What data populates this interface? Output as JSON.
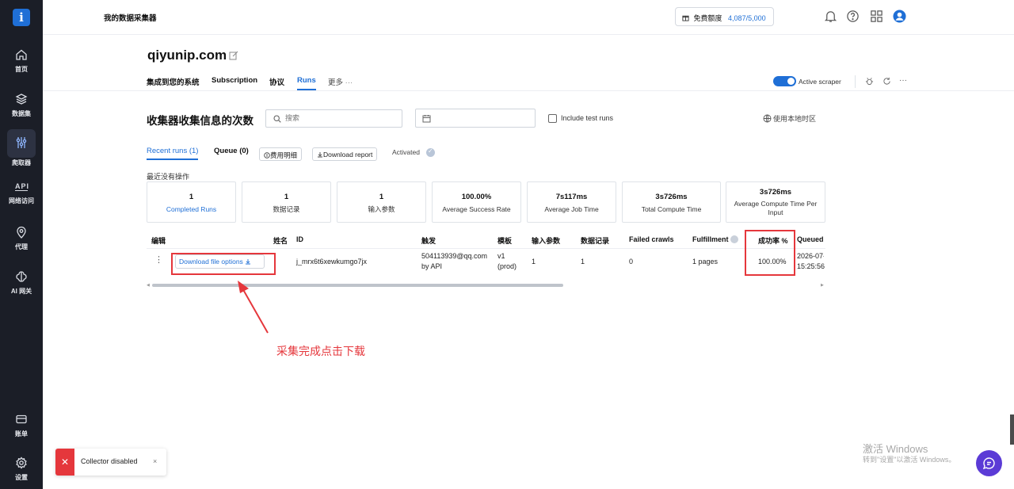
{
  "sidebar": {
    "logo": "i",
    "items": [
      {
        "label": "首页",
        "icon": "home-icon"
      },
      {
        "label": "数据集",
        "icon": "dataset-icon"
      },
      {
        "label": "爬取器",
        "icon": "scraper-icon",
        "active": true
      },
      {
        "label": "网络访问",
        "icon": "api-icon"
      },
      {
        "label": "代理",
        "icon": "proxy-pin-icon"
      },
      {
        "label": "AI 网关",
        "icon": "ai-gateway-icon"
      },
      {
        "label": "账单",
        "icon": "billing-icon"
      },
      {
        "label": "设置",
        "icon": "settings-gear-icon"
      }
    ],
    "api_text": "API"
  },
  "header": {
    "app_title": "我的数据采集器",
    "quota_label": "免费额度",
    "quota_value": "4,087/5,000"
  },
  "page": {
    "site_title": "qiyunip.com",
    "tabs": [
      "集成到您的系统",
      "Subscription",
      "协议",
      "Runs",
      "更多"
    ],
    "active_tab": "Runs",
    "more_dots": "···",
    "toggle_label": "Active scraper",
    "toggle_on": true,
    "header_dots": "···"
  },
  "runs": {
    "title": "收集器收集信息的次数",
    "search_placeholder": "搜索",
    "include_test_label": "Include test runs",
    "timezone_label": "使用本地时区",
    "subtabs": [
      "Recent runs (1)",
      "Queue (0)"
    ],
    "fees_label": "费用明细",
    "download_report": "Download report",
    "activated": "Activated",
    "recent_label": "最近没有操作",
    "stats": [
      {
        "value": "1",
        "label": "Completed Runs"
      },
      {
        "value": "1",
        "label": "数据记录"
      },
      {
        "value": "1",
        "label": "输入参数"
      },
      {
        "value": "100.00%",
        "label": "Average Success Rate"
      },
      {
        "value": "7s117ms",
        "label": "Average Job Time"
      },
      {
        "value": "3s726ms",
        "label": "Total Compute Time"
      },
      {
        "value": "3s726ms",
        "label": "Average Compute Time Per Input"
      }
    ],
    "table": {
      "headers": [
        "编辑",
        "姓名",
        "ID",
        "触发",
        "模板",
        "输入参数",
        "数据记录",
        "Failed crawls",
        "Fulfillment",
        "成功率 %",
        "Queued"
      ],
      "row": {
        "menu": "⋮",
        "download": "Download file options",
        "id": "j_mrx6t6xewkumgo7jx",
        "trigger_line1": "504113939@qq.com",
        "trigger_line2": "by API",
        "template_line1": "v1",
        "template_line2": "(prod)",
        "inputs": "1",
        "records": "1",
        "failed": "0",
        "fulfillment": "1 pages",
        "success": "100.00%",
        "queued_line1": "2026-07-",
        "queued_line2": "15:25:56"
      }
    }
  },
  "annotation": {
    "text": "采集完成点击下载",
    "color": "#e5373c"
  },
  "toast": {
    "message": "Collector disabled",
    "close": "×"
  },
  "watermark": {
    "line1": "激活 Windows",
    "line2": "转到\"设置\"以激活 Windows。"
  },
  "colors": {
    "accent": "#1f6fd6",
    "sidebar": "#1b1e27",
    "annotation": "#e5373c"
  }
}
